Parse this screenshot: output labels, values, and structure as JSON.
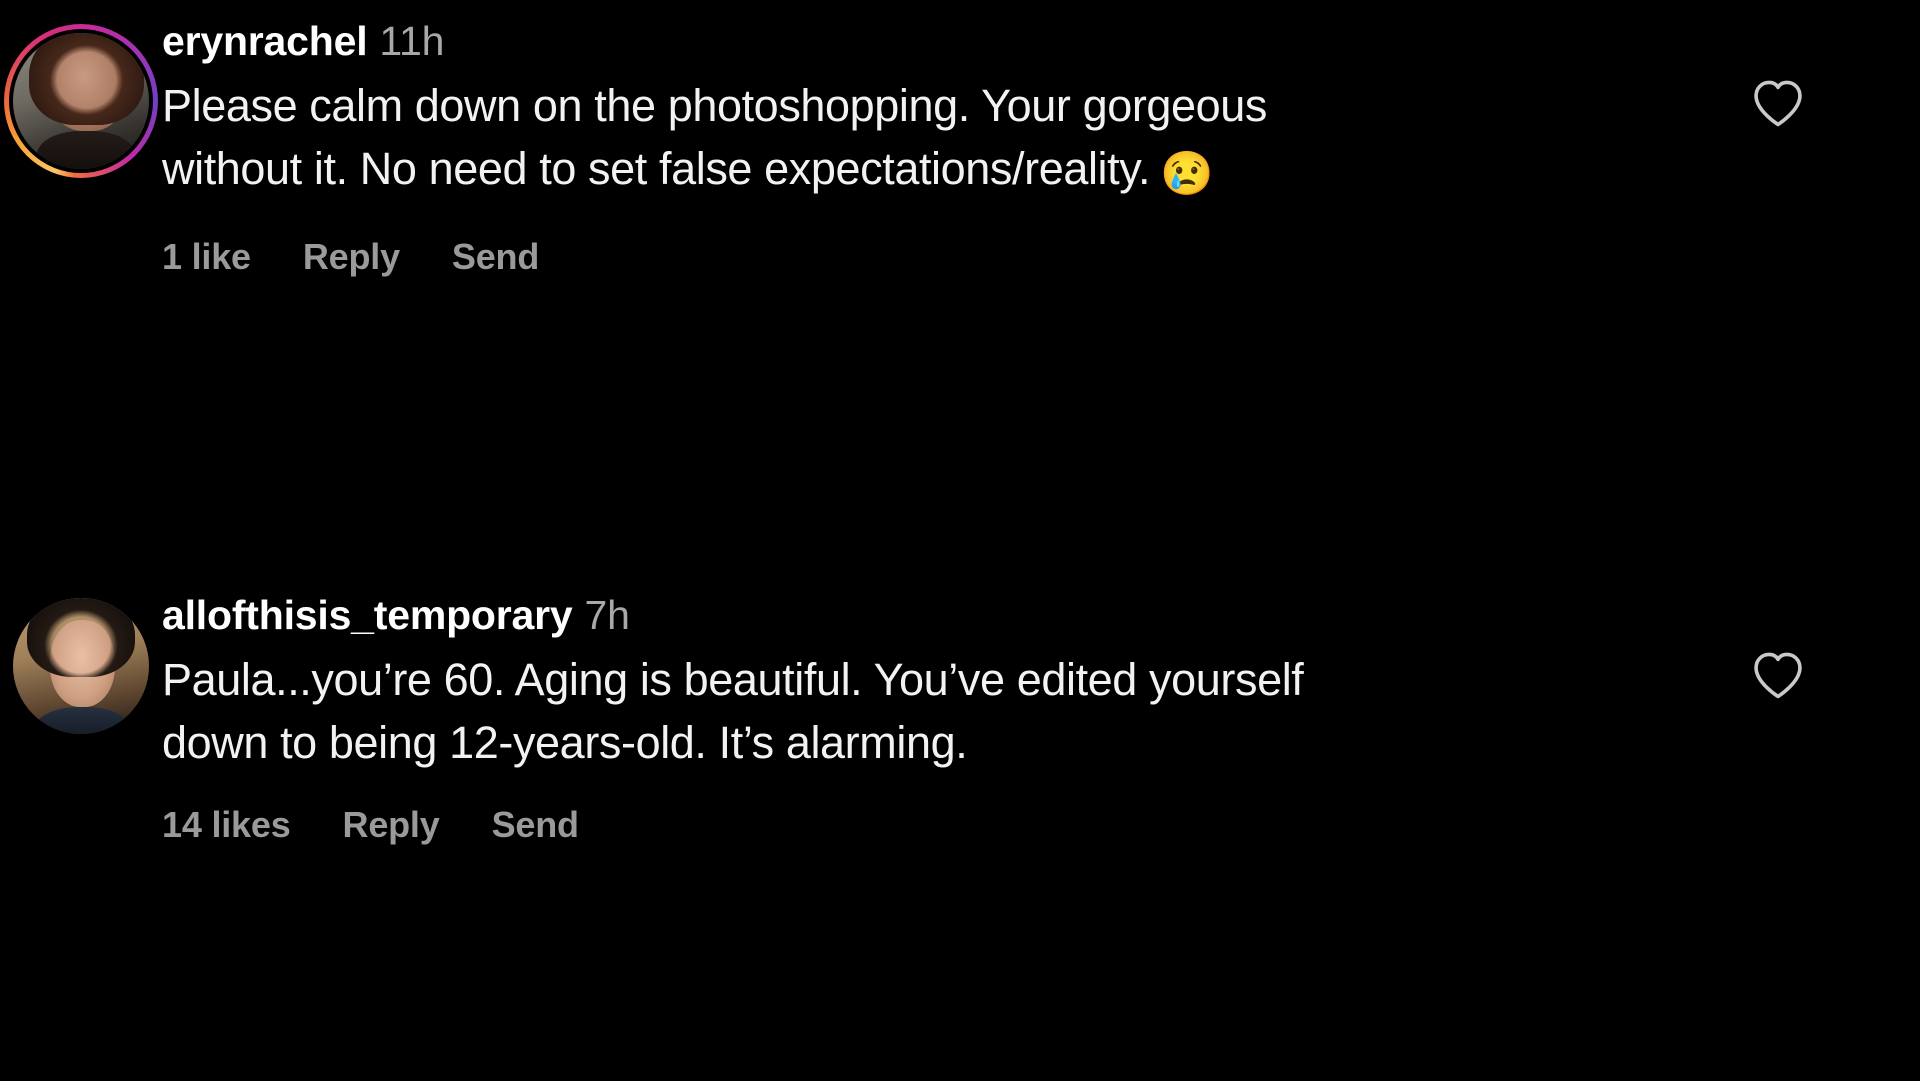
{
  "app": {
    "name": "instagram-comments",
    "background_color": "#000000",
    "text_color": "#f2f2f2",
    "muted_text_color": "#a8a8a8",
    "action_text_color": "#9a9a9a",
    "story_ring_gradient": [
      "#fdc468",
      "#f7a43a",
      "#e8623f",
      "#d92d7a",
      "#c32aa3",
      "#9b36b7",
      "#6f3fc5"
    ]
  },
  "comments": [
    {
      "username": "erynrachel",
      "timestamp": "11h",
      "text": "Please calm down on the photoshopping. Your gorgeous without it. No need to set false expectations/reality.",
      "emoji": "😢",
      "has_story_ring": true,
      "avatar_alt": "erynrachel profile photo",
      "likes_label": "1 like",
      "reply_label": "Reply",
      "send_label": "Send",
      "like_icon": "heart-outline-icon",
      "liked": false
    },
    {
      "username": "allofthisis_temporary",
      "timestamp": "7h",
      "text": "Paula...you’re 60. Aging is beautiful. You’ve edited yourself down to being 12-years-old. It’s alarming.",
      "emoji": "",
      "has_story_ring": false,
      "avatar_alt": "allofthisis_temporary profile photo",
      "likes_label": "14 likes",
      "reply_label": "Reply",
      "send_label": "Send",
      "like_icon": "heart-outline-icon",
      "liked": false
    }
  ]
}
